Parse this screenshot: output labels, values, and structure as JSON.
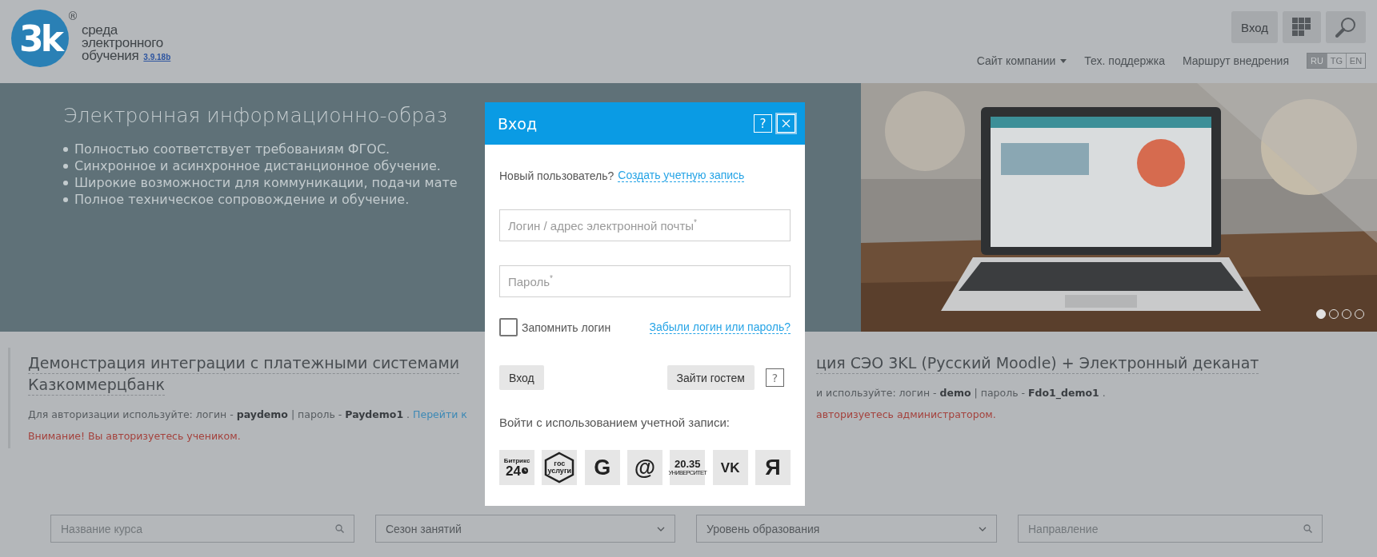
{
  "header": {
    "logo": {
      "mark": "3k",
      "registered": "®",
      "lines": [
        "среда",
        "электронного",
        "обучения"
      ],
      "version": "3.9.18b"
    },
    "login_button": "Вход",
    "nav": [
      {
        "label": "Сайт компании",
        "dropdown": true
      },
      {
        "label": "Тех. поддержка",
        "dropdown": false
      },
      {
        "label": "Маршрут внедрения",
        "dropdown": false
      }
    ],
    "languages": [
      {
        "label": "RU",
        "selected": true
      },
      {
        "label": "TG",
        "selected": false
      },
      {
        "label": "EN",
        "selected": false
      }
    ]
  },
  "hero": {
    "title": "Электронная информационно-образ",
    "bullets": [
      "Полностью соответствует требованиям ФГОС.",
      "Синхронное и асинхронное дистанционное обучение.",
      "Широкие возможности для коммуникации, подачи мате",
      "Полное техническое сопровождение и обучение."
    ],
    "slides": [
      {
        "selected": true
      },
      {
        "selected": false
      },
      {
        "selected": false
      },
      {
        "selected": false
      }
    ]
  },
  "demos": [
    {
      "title_lines": [
        "Демонстрация интеграции с платежными системами",
        "Казкоммерцбанк"
      ],
      "auth": "Для авторизации используйте: логин - **paydemo** | пароль - **Paydemo1** .",
      "link": "Перейти к",
      "warning": "Внимание! Вы авторизуетесь учеником.",
      "bordered": true
    },
    {
      "title_lines": [
        "ция СЭО 3KL (Русский Moodle) + Электронный деканат"
      ],
      "auth": "и используйте: логин - **demo** | пароль - **Fdo1_demo1** .",
      "warning": "авторизуетесь администратором.",
      "bordered": false
    }
  ],
  "filters": [
    {
      "kind": "search",
      "placeholder": "Название курса"
    },
    {
      "kind": "select",
      "value": "Сезон занятий"
    },
    {
      "kind": "select",
      "value": "Уровень образования"
    },
    {
      "kind": "search",
      "placeholder": "Направление"
    }
  ],
  "login_dialog": {
    "title": "Вход",
    "help": "?",
    "new_user": "Новый пользователь?",
    "create_account": "Создать учетную запись",
    "login_placeholder": "Логин / адрес электронной почты",
    "password_placeholder": "Пароль",
    "required_mark": "*",
    "remember": {
      "label": "Запомнить логин",
      "checked": false
    },
    "forgot": "Забыли логин или пароль?",
    "submit": "Вход",
    "guest": "Зайти гостем",
    "guest_help": "?",
    "social_title": "Войти с использованием учетной записи:",
    "social": [
      {
        "kind": "bitrix",
        "lines": [
          "Битрикс",
          "24"
        ]
      },
      {
        "kind": "gosuslugi",
        "lines": [
          "гос",
          "услуги"
        ]
      },
      {
        "kind": "letter",
        "lines": [
          "G"
        ]
      },
      {
        "kind": "letter",
        "lines": [
          "@"
        ]
      },
      {
        "kind": "u2035",
        "lines": [
          "20.35",
          "УНИВЕРСИТЕТ"
        ]
      },
      {
        "kind": "letter",
        "lines": [
          "VK"
        ]
      },
      {
        "kind": "letter",
        "lines": [
          "Я"
        ]
      }
    ]
  }
}
